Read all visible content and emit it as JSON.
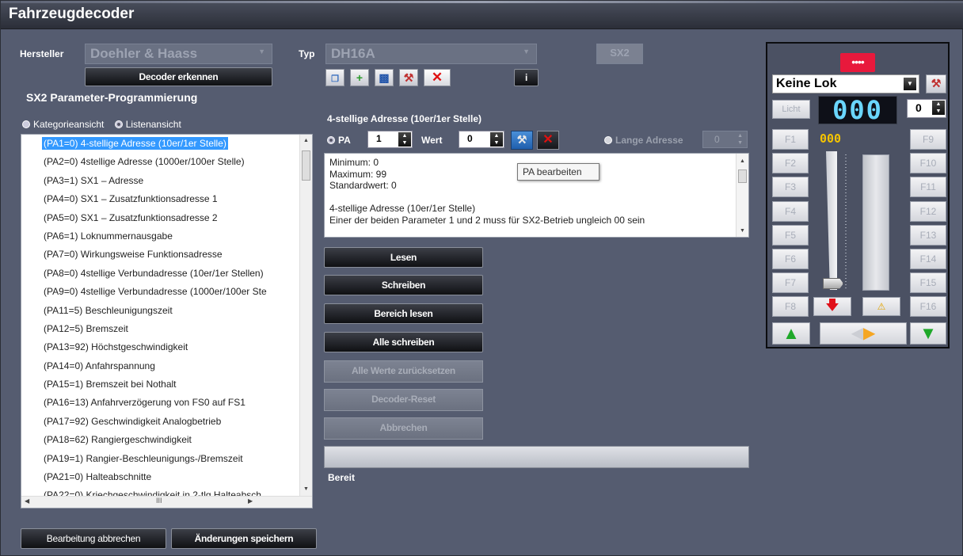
{
  "window": {
    "title": "Fahrzeugdecoder"
  },
  "header": {
    "manufacturer_label": "Hersteller",
    "manufacturer_value": "Doehler & Haass",
    "type_label": "Typ",
    "type_value": "DH16A",
    "mode_badge": "SX2",
    "detect_button": "Decoder erkennen",
    "section_title": "SX2 Parameter-Programmierung",
    "info_button": "i"
  },
  "view_options": {
    "category": "Kategorieansicht",
    "list": "Listenansicht",
    "selected": "list"
  },
  "parameters": [
    "(PA1=0) 4-stellige Adresse (10er/1er Stelle)",
    "(PA2=0) 4stellige Adresse (1000er/100er Stelle)",
    "(PA3=1) SX1 – Adresse",
    "(PA4=0) SX1 – Zusatzfunktionsadresse 1",
    "(PA5=0) SX1 – Zusatzfunktionsadresse 2",
    "(PA6=1) Loknummernausgabe",
    "(PA7=0) Wirkungsweise Funktionsadresse",
    "(PA8=0) 4stellige Verbundadresse (10er/1er Stellen)",
    "(PA9=0) 4stellige Verbundadresse (1000er/100er Ste",
    "(PA11=5) Beschleunigungszeit",
    "(PA12=5) Bremszeit",
    "(PA13=92) Höchstgeschwindigkeit",
    "(PA14=0) Anfahrspannung",
    "(PA15=1) Bremszeit bei Nothalt",
    "(PA16=13) Anfahrverzögerung von FS0 auf FS1",
    "(PA17=92) Geschwindigkeit Analogbetrieb",
    "(PA18=62) Rangiergeschwindigkeit",
    "(PA19=1) Rangier-Beschleunigungs-/Bremszeit",
    "(PA21=0) Halteabschnitte",
    "(PA22=0) Kriechgeschwindigkeit in 2-tlg Halteabsch"
  ],
  "list_scroll": {
    "h_marker": "III"
  },
  "editor": {
    "title": "4-stellige Adresse (10er/1er Stelle)",
    "pa_label": "PA",
    "pa_value": "1",
    "value_label": "Wert",
    "value_value": "0",
    "long_address_label": "Lange Adresse",
    "long_address_value": "0",
    "tooltip": "PA bearbeiten",
    "info_lines": [
      "Minimum: 0",
      "Maximum: 99",
      "Standardwert: 0",
      "",
      "4-stellige Adresse (10er/1er Stelle)",
      "Einer der beiden Parameter 1 und 2 muss für SX2-Betrieb ungleich 00 sein"
    ]
  },
  "actions": {
    "read": "Lesen",
    "write": "Schreiben",
    "read_range": "Bereich lesen",
    "write_all": "Alle schreiben",
    "reset_values": "Alle Werte zurücksetzen",
    "decoder_reset": "Decoder-Reset",
    "cancel": "Abbrechen"
  },
  "status": {
    "text": "Bereit",
    "progress": 0
  },
  "footer": {
    "cancel_edit": "Bearbeitung abbrechen",
    "save_changes": "Änderungen speichern"
  },
  "throttle": {
    "loco": "Keine Lok",
    "light_label": "Licht",
    "speed_display": "000",
    "step_value": "0",
    "small_display": "000",
    "fkeys_left": [
      "F1",
      "F2",
      "F3",
      "F4",
      "F5",
      "F6",
      "F7",
      "F8"
    ],
    "fkeys_right": [
      "F9",
      "F10",
      "F11",
      "F12",
      "F13",
      "F14",
      "F15",
      "F16"
    ],
    "colors": {
      "red_led": "#e8193c",
      "green": "#1fa82a",
      "orange": "#f5a623"
    }
  }
}
